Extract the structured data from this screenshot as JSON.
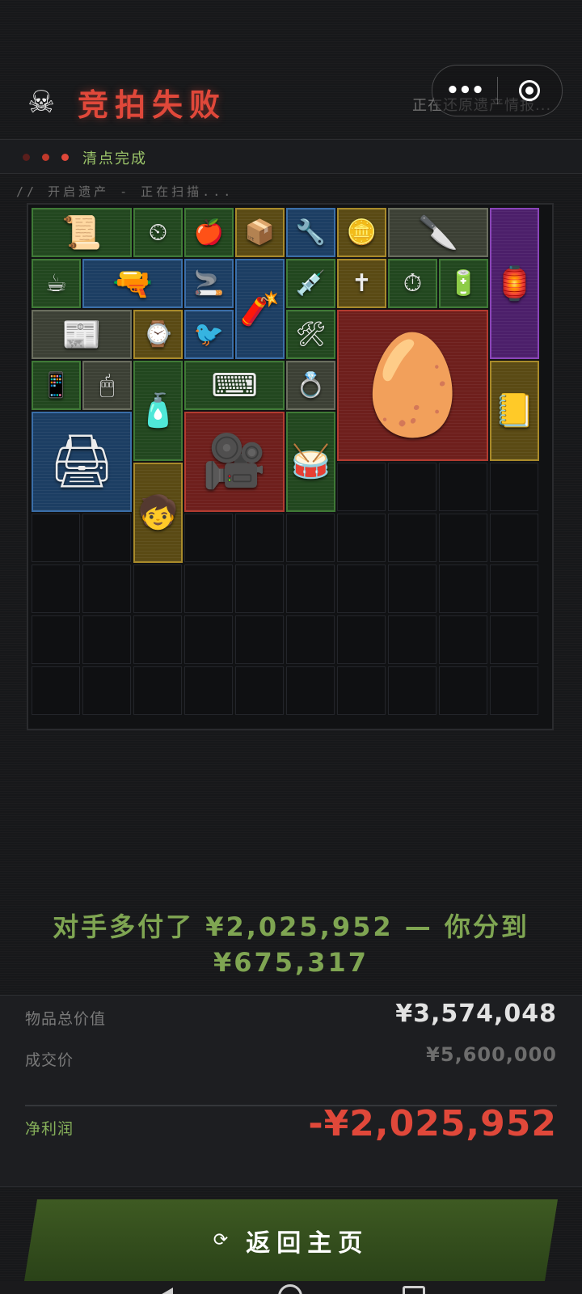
{
  "header": {
    "title": "竞拍失败",
    "scan_status": "正在还原遗产情报...",
    "capsule_more_icon": "more-dots-icon",
    "capsule_target_icon": "target-icon"
  },
  "status": {
    "text": "清点完成",
    "dot_colors": [
      "#5a1e1c",
      "#c0392b",
      "#e0483a"
    ]
  },
  "scan_line": "// 开启遗产 - 正在扫描...",
  "inventory": {
    "columns": 10,
    "rows": 10,
    "items": [
      {
        "name": "old-letter",
        "icon": "📜",
        "rarity": "green"
      },
      {
        "name": "pressure-gauge",
        "icon": "⏲",
        "rarity": "green"
      },
      {
        "name": "apple",
        "icon": "🍎",
        "rarity": "green"
      },
      {
        "name": "device-box",
        "icon": "📦",
        "rarity": "gold"
      },
      {
        "name": "multitool",
        "icon": "🔧",
        "rarity": "blue"
      },
      {
        "name": "gold-coin",
        "icon": "🪙",
        "rarity": "gold"
      },
      {
        "name": "utility-knife",
        "icon": "🔪",
        "rarity": "gray"
      },
      {
        "name": "lantern",
        "icon": "🏮",
        "rarity": "purple"
      },
      {
        "name": "coffee-jar",
        "icon": "☕",
        "rarity": "green"
      },
      {
        "name": "rifle-parts",
        "icon": "🔫",
        "rarity": "blue"
      },
      {
        "name": "cigarette-box",
        "icon": "🚬",
        "rarity": "blue"
      },
      {
        "name": "ammo-box",
        "icon": "🧨",
        "rarity": "blue"
      },
      {
        "name": "medicine-vial",
        "icon": "💉",
        "rarity": "green"
      },
      {
        "name": "gold-cross",
        "icon": "✝",
        "rarity": "gold"
      },
      {
        "name": "gauge-small",
        "icon": "⏱",
        "rarity": "green"
      },
      {
        "name": "batteries",
        "icon": "🔋",
        "rarity": "green"
      },
      {
        "name": "newspaper",
        "icon": "📰",
        "rarity": "gray"
      },
      {
        "name": "pocket-watch",
        "icon": "⌚",
        "rarity": "gold"
      },
      {
        "name": "bird-figure",
        "icon": "🐦",
        "rarity": "blue"
      },
      {
        "name": "pliers",
        "icon": "🛠",
        "rarity": "green"
      },
      {
        "name": "jeweled-egg",
        "icon": "🥚",
        "rarity": "red"
      },
      {
        "name": "phone-battery",
        "icon": "📱",
        "rarity": "green"
      },
      {
        "name": "computer-mouse",
        "icon": "🖱",
        "rarity": "gray"
      },
      {
        "name": "spray-can",
        "icon": "🧴",
        "rarity": "green"
      },
      {
        "name": "keyboard",
        "icon": "⌨",
        "rarity": "green"
      },
      {
        "name": "jewelry-box",
        "icon": "💍",
        "rarity": "gray"
      },
      {
        "name": "leather-journal",
        "icon": "📒",
        "rarity": "gold"
      },
      {
        "name": "smart-device",
        "icon": "🖨",
        "rarity": "blue"
      },
      {
        "name": "video-camera",
        "icon": "🎥",
        "rarity": "red"
      },
      {
        "name": "djembe-drum",
        "icon": "🥁",
        "rarity": "green"
      },
      {
        "name": "boy-figurine",
        "icon": "🧒",
        "rarity": "gold"
      }
    ]
  },
  "summary": {
    "line1": "对手多付了 ¥2,025,952 — 你分到",
    "line2": "¥675,317"
  },
  "stats": {
    "total_value_label": "物品总价值",
    "total_value": "¥3,574,048",
    "deal_price_label": "成交价",
    "deal_price": "¥5,600,000",
    "net_profit_label": "净利润",
    "net_profit": "-¥2,025,952"
  },
  "colors": {
    "loss": "#e0483a",
    "accent_green": "#7fa552",
    "button_green": "#3e5a22"
  },
  "back_button": {
    "label": "返回主页",
    "icon": "refresh-icon"
  }
}
